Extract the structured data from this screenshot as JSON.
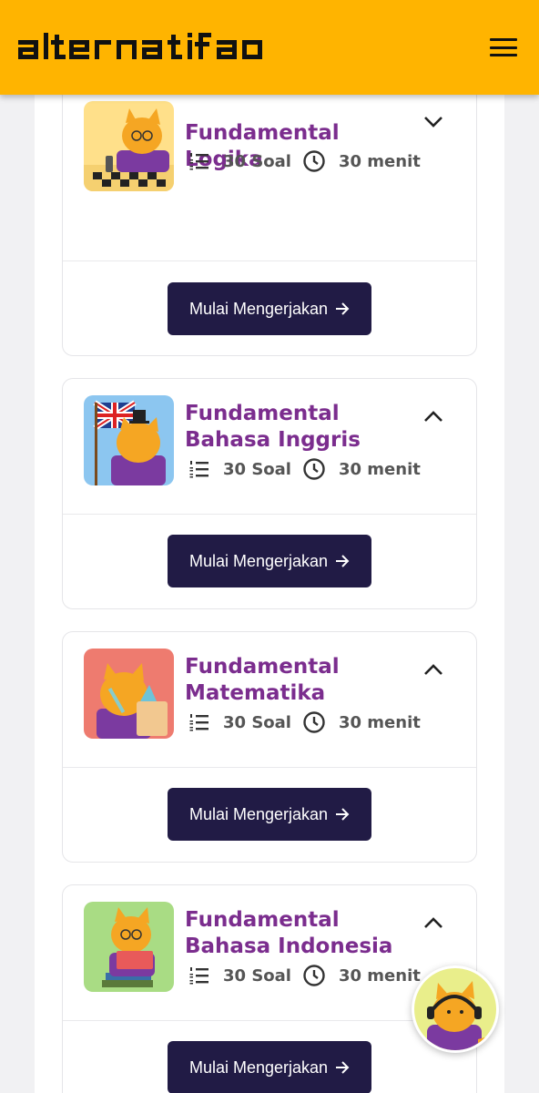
{
  "header": {
    "logo_text": "alternatifa",
    "menu_icon": "hamburger-icon",
    "background": "#ffb400"
  },
  "cards": [
    {
      "title": "Fundamental Logika",
      "questions": "30 Soal",
      "duration": "30 menit",
      "button_label": "Mulai Mengerjakan",
      "expanded": false,
      "thumb_bg": "#ffe08a"
    },
    {
      "title": "Fundamental Bahasa Inggris",
      "questions": "30 Soal",
      "duration": "30 menit",
      "button_label": "Mulai Mengerjakan",
      "expanded": true,
      "thumb_bg": "#8cc6f0"
    },
    {
      "title": "Fundamental Matematika",
      "questions": "30 Soal",
      "duration": "30 menit",
      "button_label": "Mulai Mengerjakan",
      "expanded": true,
      "thumb_bg": "#ee7b6f"
    },
    {
      "title": "Fundamental Bahasa Indonesia",
      "questions": "30 Soal",
      "duration": "30 menit",
      "button_label": "Mulai Mengerjakan",
      "expanded": true,
      "thumb_bg": "#a9dc84"
    }
  ],
  "colors": {
    "title": "#7b2d8e",
    "button": "#211b45",
    "accent": "#ffb400"
  }
}
